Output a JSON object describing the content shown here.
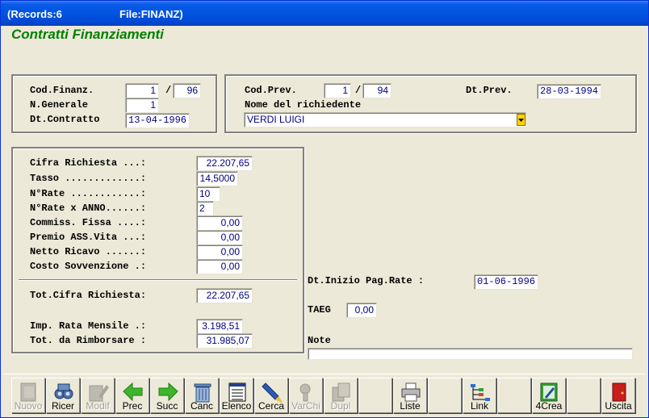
{
  "window": {
    "records": "(Records:6",
    "file": "File:FINANZ)"
  },
  "form_title": "Contratti Finanziamenti",
  "group1": {
    "cod_finanz_label": "Cod.Finanz.",
    "cod_finanz_num": "1",
    "cod_finanz_slash": "/",
    "cod_finanz_year": "96",
    "n_generale_label": "N.Generale",
    "n_generale": "1",
    "dt_contratto_label": "Dt.Contratto",
    "dt_contratto": "13-04-1996"
  },
  "group2": {
    "cod_prev_label": "Cod.Prev.",
    "cod_prev_num": "1",
    "cod_prev_slash": "/",
    "cod_prev_year": "94",
    "dt_prev_label": "Dt.Prev.",
    "dt_prev": "28-03-1994",
    "nome_label": "Nome del richiedente",
    "nome": "VERDI LUIGI"
  },
  "group3": {
    "cifra_label": "Cifra Richiesta ...:",
    "cifra": "22.207,65",
    "tasso_label": "Tasso .............:",
    "tasso": "14,5000",
    "nrate_label": "N°Rate ............:",
    "nrate": "10",
    "nrate_anno_label": "N°Rate x ANNO......:",
    "nrate_anno": "2",
    "commiss_label": "Commiss. Fissa ....:",
    "commiss": "0,00",
    "premio_label": "Premio ASS.Vita ...:",
    "premio": "0,00",
    "netto_label": "Netto Ricavo ......:",
    "netto": "0,00",
    "costo_label": "Costo Sovvenzione .:",
    "costo": "0,00",
    "tot_cifra_label": "Tot.Cifra Richiesta:",
    "tot_cifra": "22.207,65",
    "imp_rata_label": "Imp. Rata Mensile .:",
    "imp_rata": "3.198,51",
    "tot_rimb_label": "Tot. da Rimborsare :",
    "tot_rimb": "31.985,07"
  },
  "right": {
    "dt_inizio_label": "Dt.Inizio Pag.Rate :",
    "dt_inizio": "01-06-1996",
    "taeg_label": "TAEG",
    "taeg": "0,00",
    "note_label": "Note",
    "note": ""
  },
  "toolbar": {
    "nuovo": "Nuovo",
    "ricer": "Ricer",
    "modif": "Modif",
    "prec": "Prec",
    "succ": "Succ",
    "canc": "Canc",
    "elenco": "Elenco",
    "cerca": "Cerca",
    "varchi": "VarChi",
    "dupl": "Dupl",
    "liste": "Liste",
    "link": "Link",
    "crea": "4Crea",
    "uscita": "Uscita"
  },
  "colors": {
    "title_green": "#008000",
    "field_text": "#000080",
    "titlebar": "#0053e1"
  }
}
